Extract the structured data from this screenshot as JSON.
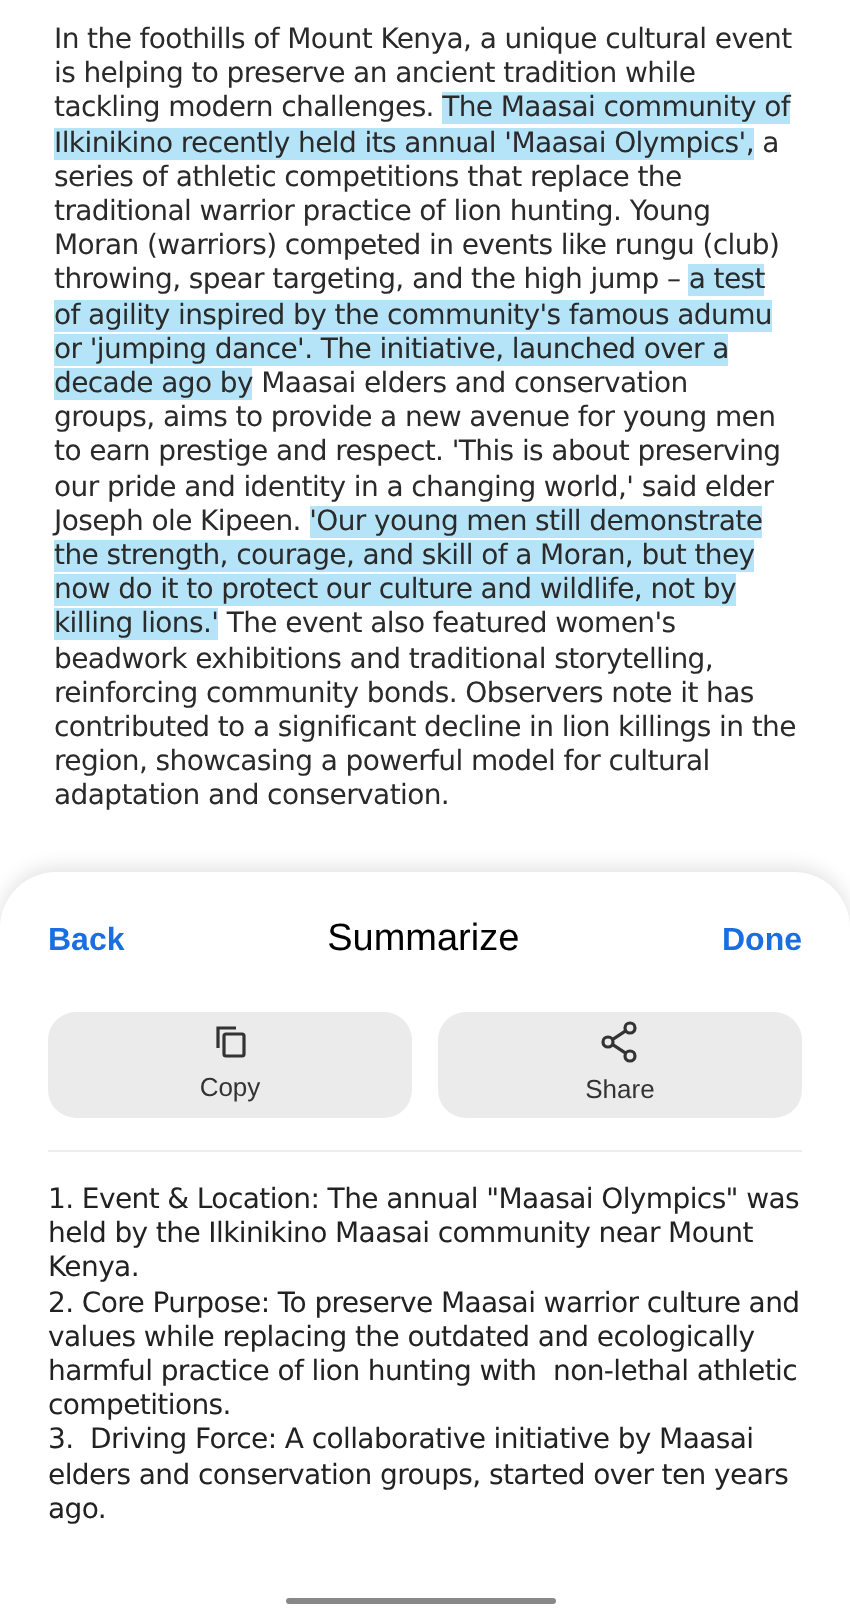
{
  "article": {
    "segments": [
      {
        "text": "In the foothills of Mount Kenya, a unique cultural event is helping to preserve an ancient tradition while tackling modern challenges. ",
        "highlighted": false
      },
      {
        "text": "The Maasai community of Ilkinikino recently held its annual 'Maasai Olympics',",
        "highlighted": true
      },
      {
        "text": " a series of athletic competitions that replace the traditional warrior practice of lion hunting. Young Moran (warriors) competed in events like rungu (club) throwing, spear targeting, and the high jump – ",
        "highlighted": false
      },
      {
        "text": "a test of agility inspired by the community's famous adumu or 'jumping dance'. The initiative, launched over a decade ago by",
        "highlighted": true
      },
      {
        "text": " Maasai elders and conservation groups, aims to provide a new avenue for young men to earn prestige and respect. 'This is about preserving our pride and identity in a changing world,' said elder Joseph ole Kipeen. ",
        "highlighted": false
      },
      {
        "text": "'Our young men still demonstrate the strength, courage, and skill of a Moran, but they now do it to protect our culture and wildlife, not by killing lions.'",
        "highlighted": true
      },
      {
        "text": " The event also featured women's beadwork exhibitions and traditional storytelling, reinforcing community bonds. Observers note it has contributed to a significant decline in lion killings in the region, showcasing a powerful model for cultural adaptation and conservation.",
        "highlighted": false
      }
    ]
  },
  "sheet": {
    "back": "Back",
    "title": "Summarize",
    "done": "Done",
    "actions": [
      {
        "kind": "copy",
        "label": "Copy"
      },
      {
        "kind": "share",
        "label": "Share"
      }
    ],
    "summary": [
      "1. Event & Location: The annual \"Maasai Olympics\" was held by the Ilkinikino Maasai community near Mount Kenya.",
      "2. Core Purpose: To preserve Maasai warrior culture and values while replacing the outdated and ecologically harmful practice of lion hunting with  non-lethal athletic competitions.",
      "3.  Driving Force: A collaborative initiative by Maasai elders and conservation groups, started over ten years ago."
    ]
  }
}
